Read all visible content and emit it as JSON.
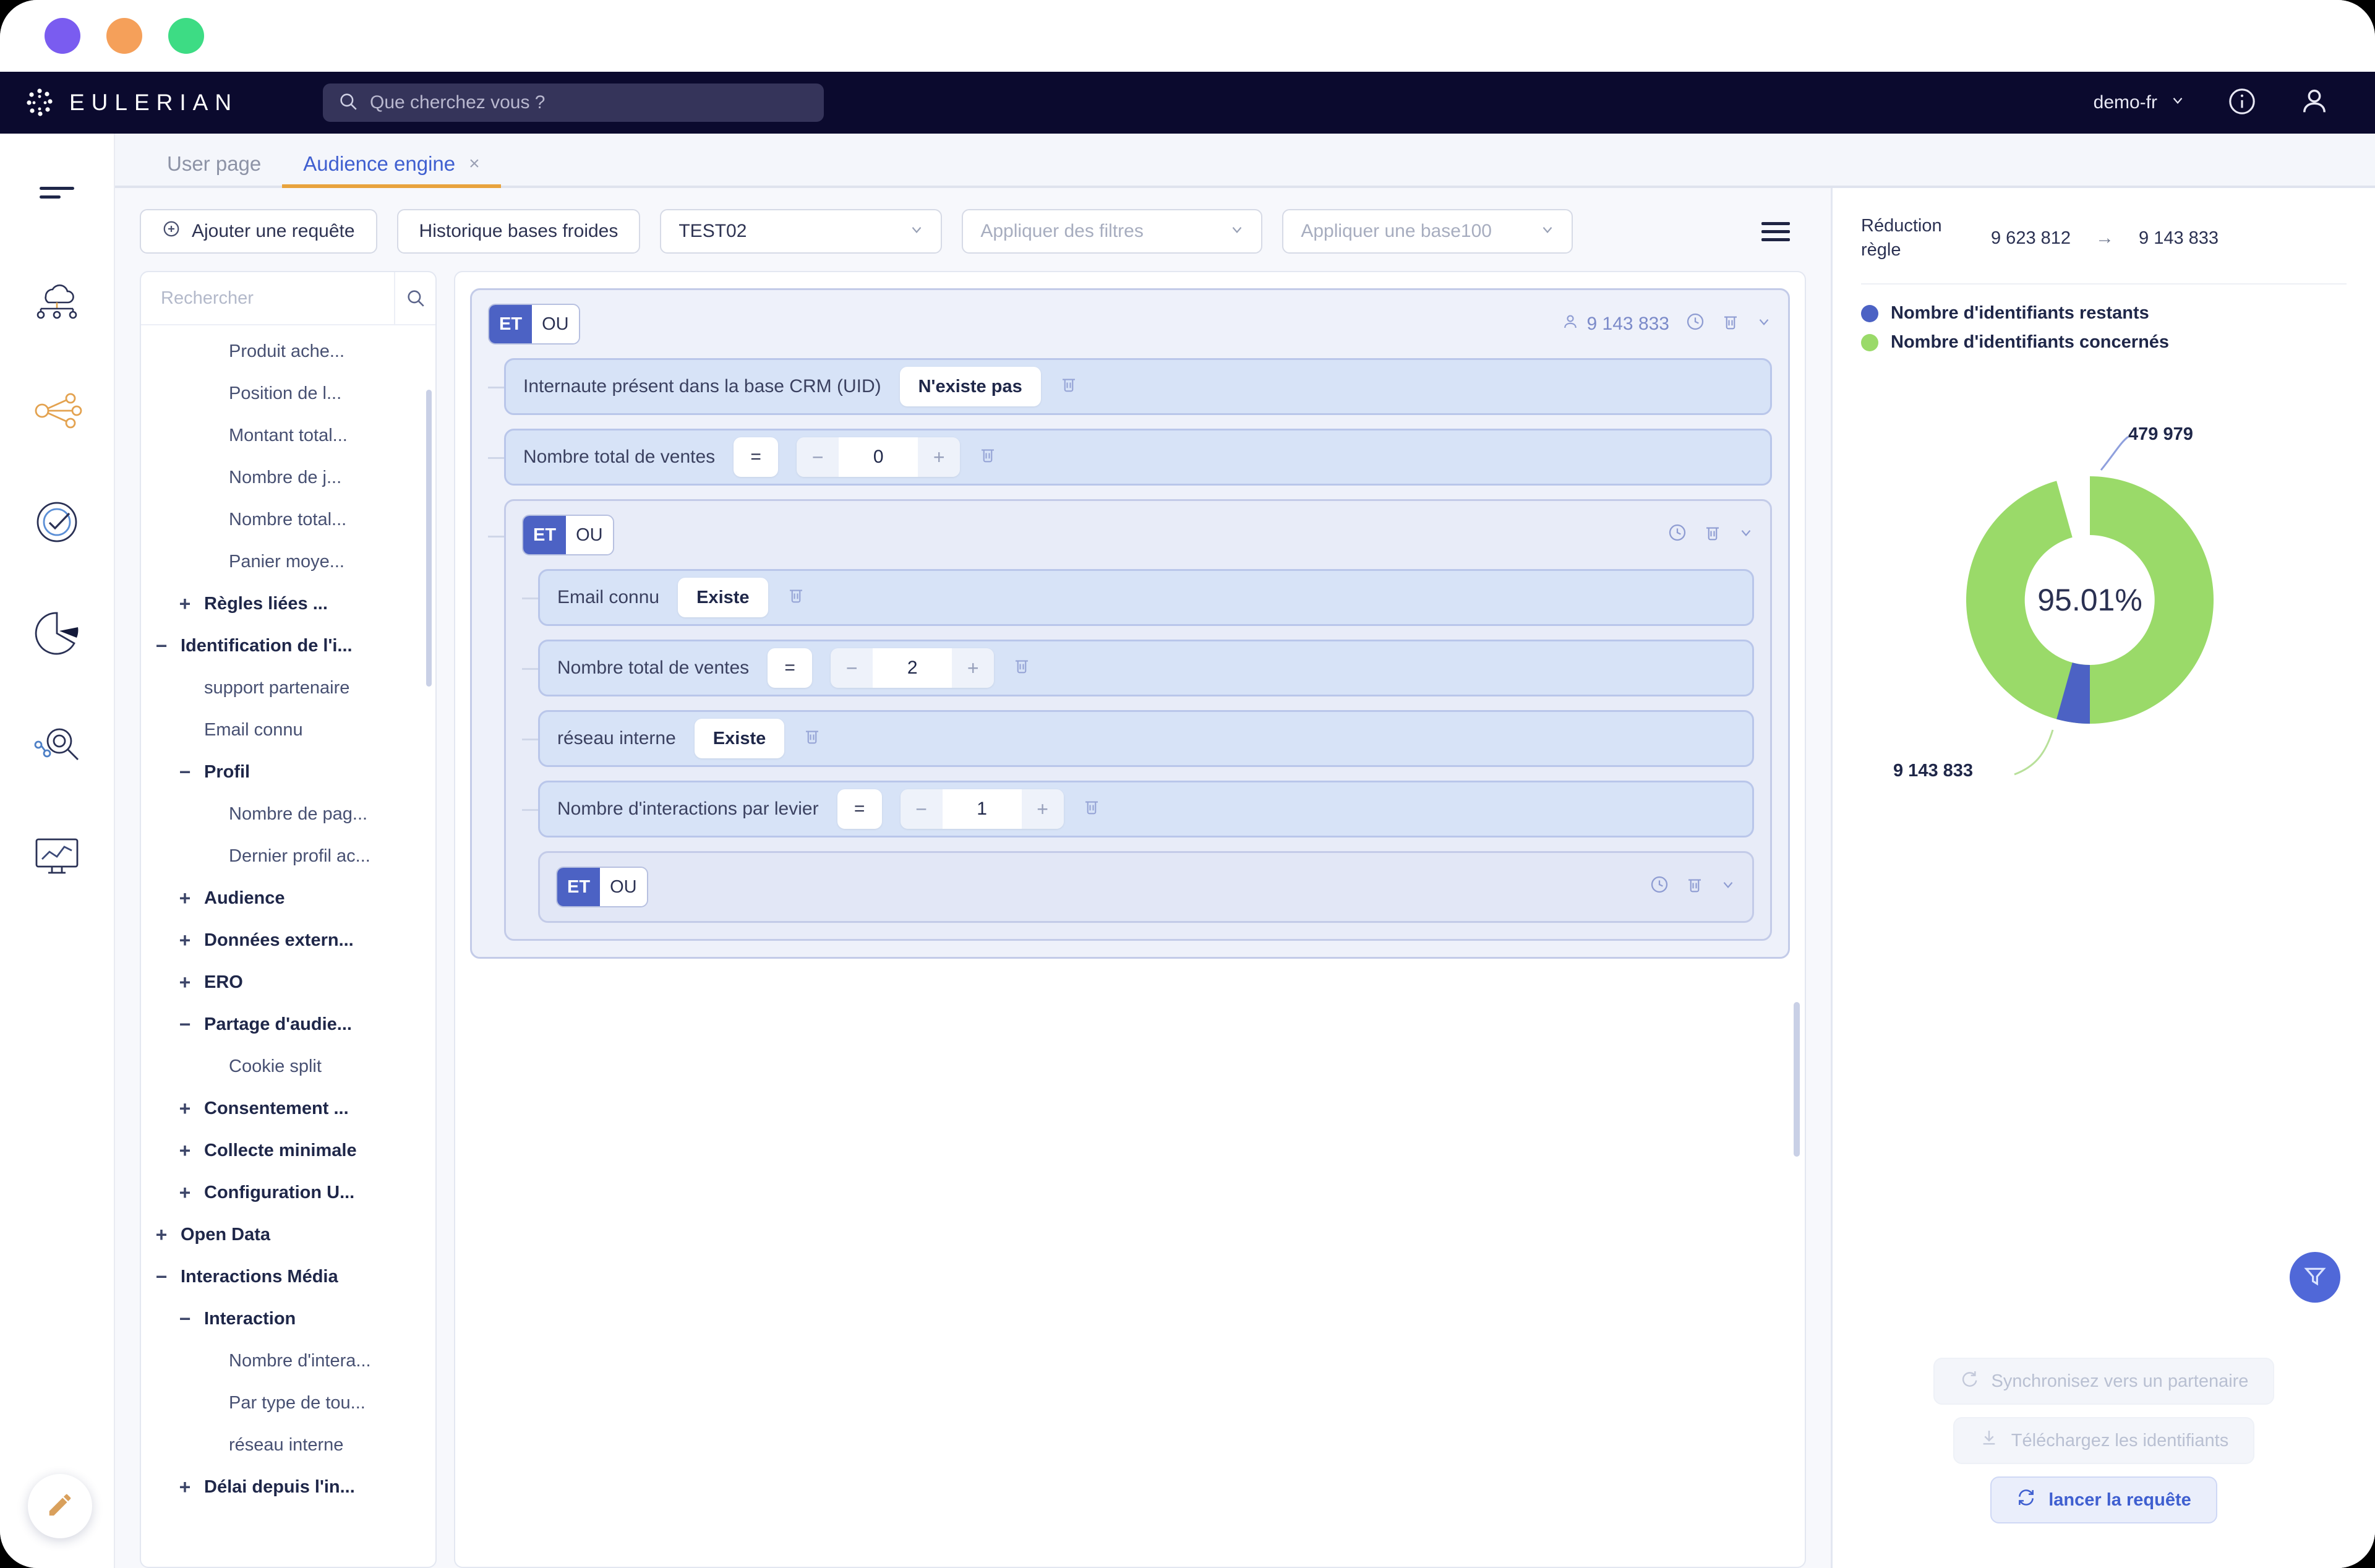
{
  "window": {
    "traffic_lights": [
      "close-purple",
      "minimize-orange",
      "zoom-green"
    ]
  },
  "header": {
    "brand": "EULERIAN",
    "search_placeholder": "Que cherchez vous ?",
    "account": "demo-fr",
    "info_icon": "info-icon",
    "user_icon": "user-icon"
  },
  "rail": {
    "items": [
      {
        "name": "menu-icon",
        "label": "menu"
      },
      {
        "name": "cloud-network-icon",
        "label": "Collecte"
      },
      {
        "name": "share-nodes-icon",
        "label": "Partage"
      },
      {
        "name": "target-check-icon",
        "label": "Objectifs"
      },
      {
        "name": "pie-chart-icon",
        "label": "Analyses"
      },
      {
        "name": "search-insights-icon",
        "label": "Exploration"
      },
      {
        "name": "monitor-chart-icon",
        "label": "Dashboards"
      }
    ],
    "fab_icon": "pencil-icon"
  },
  "tabs": [
    {
      "label": "User page",
      "active": false,
      "closable": false
    },
    {
      "label": "Audience engine",
      "active": true,
      "closable": true,
      "close_label": "×"
    }
  ],
  "toolbar": {
    "add_query_label": "Ajouter une requête",
    "add_query_icon": "plus-circle-icon",
    "cold_bases_label": "Historique bases froides",
    "segment_value": "TEST02",
    "filters_placeholder": "Appliquer des filtres",
    "base100_placeholder": "Appliquer une base100",
    "menu_icon": "hamburger-menu-icon"
  },
  "tree": {
    "search_placeholder": "Rechercher",
    "search_value": "",
    "search_icon": "search-icon",
    "nodes": [
      {
        "label": "Produit ache...",
        "level": 2,
        "toggle": "",
        "bold": false
      },
      {
        "label": "Position de l...",
        "level": 2,
        "toggle": "",
        "bold": false
      },
      {
        "label": "Montant total...",
        "level": 2,
        "toggle": "",
        "bold": false
      },
      {
        "label": "Nombre de j...",
        "level": 2,
        "toggle": "",
        "bold": false
      },
      {
        "label": "Nombre total...",
        "level": 2,
        "toggle": "",
        "bold": false
      },
      {
        "label": "Panier moye...",
        "level": 2,
        "toggle": "",
        "bold": false
      },
      {
        "label": "Règles liées ...",
        "level": 1,
        "toggle": "+",
        "bold": true
      },
      {
        "label": "Identification de l'i...",
        "level": 0,
        "toggle": "−",
        "bold": true
      },
      {
        "label": "support partenaire",
        "level": 1,
        "toggle": "",
        "bold": false
      },
      {
        "label": "Email connu",
        "level": 1,
        "toggle": "",
        "bold": false
      },
      {
        "label": "Profil",
        "level": 1,
        "toggle": "−",
        "bold": true
      },
      {
        "label": "Nombre de pag...",
        "level": 2,
        "toggle": "",
        "bold": false
      },
      {
        "label": "Dernier profil ac...",
        "level": 2,
        "toggle": "",
        "bold": false
      },
      {
        "label": "Audience",
        "level": 1,
        "toggle": "+",
        "bold": true
      },
      {
        "label": "Données extern...",
        "level": 1,
        "toggle": "+",
        "bold": true
      },
      {
        "label": "ERO",
        "level": 1,
        "toggle": "+",
        "bold": true
      },
      {
        "label": "Partage d'audie...",
        "level": 1,
        "toggle": "−",
        "bold": true
      },
      {
        "label": "Cookie split",
        "level": 2,
        "toggle": "",
        "bold": false
      },
      {
        "label": "Consentement ...",
        "level": 1,
        "toggle": "+",
        "bold": true
      },
      {
        "label": "Collecte minimale",
        "level": 1,
        "toggle": "+",
        "bold": true
      },
      {
        "label": "Configuration U...",
        "level": 1,
        "toggle": "+",
        "bold": true
      },
      {
        "label": "Open Data",
        "level": 0,
        "toggle": "+",
        "bold": true
      },
      {
        "label": "Interactions Média",
        "level": 0,
        "toggle": "−",
        "bold": true
      },
      {
        "label": "Interaction",
        "level": 1,
        "toggle": "−",
        "bold": true
      },
      {
        "label": "Nombre d'intera...",
        "level": 2,
        "toggle": "",
        "bold": false
      },
      {
        "label": "Par type de tou...",
        "level": 2,
        "toggle": "",
        "bold": false
      },
      {
        "label": "réseau interne",
        "level": 2,
        "toggle": "",
        "bold": false
      },
      {
        "label": "Délai depuis l'in...",
        "level": 1,
        "toggle": "+",
        "bold": true
      }
    ]
  },
  "query": {
    "root": {
      "operator_on": "ET",
      "operator_off": "OU",
      "count": "9 143 833",
      "count_icon": "user-count-icon",
      "clock_icon": "history-icon",
      "delete_icon": "trash-icon",
      "caret_icon": "chevron-down-icon"
    },
    "rules_level1": [
      {
        "label": "Internaute présent dans la base CRM (UID)",
        "kind": "exists",
        "chip": "N'existe pas",
        "delete_icon": "trash-icon"
      },
      {
        "label": "Nombre total de ventes",
        "kind": "number",
        "operator": "=",
        "minus": "−",
        "value": "0",
        "plus": "+",
        "delete_icon": "trash-icon"
      }
    ],
    "group2": {
      "operator_on": "ET",
      "operator_off": "OU",
      "clock_icon": "history-icon",
      "delete_icon": "trash-icon",
      "caret_icon": "chevron-down-icon",
      "rules": [
        {
          "label": "Email connu",
          "kind": "exists",
          "chip": "Existe",
          "delete_icon": "trash-icon"
        },
        {
          "label": "Nombre total de ventes",
          "kind": "number",
          "operator": "=",
          "minus": "−",
          "value": "2",
          "plus": "+",
          "delete_icon": "trash-icon"
        },
        {
          "label": "réseau interne",
          "kind": "exists",
          "chip": "Existe",
          "delete_icon": "trash-icon"
        },
        {
          "label": "Nombre d'interactions par levier",
          "kind": "number",
          "operator": "=",
          "minus": "−",
          "value": "1",
          "plus": "+",
          "delete_icon": "trash-icon"
        }
      ],
      "group3": {
        "operator_on": "ET",
        "operator_off": "OU",
        "clock_icon": "history-icon",
        "delete_icon": "trash-icon",
        "caret_icon": "chevron-down-icon"
      }
    }
  },
  "panel": {
    "reduction_label": "Réduction règle",
    "reduction_from": "9 623 812",
    "reduction_arrow": "→",
    "reduction_to": "9 143 833",
    "legend": [
      {
        "label": "Nombre d'identifiants restants",
        "color": "#4c62c4"
      },
      {
        "label": "Nombre d'identifiants concernés",
        "color": "#9ada69"
      }
    ],
    "filter_fab_icon": "funnel-icon",
    "actions": [
      {
        "label": "Synchronisez vers un partenaire",
        "icon": "sync-arrow-icon",
        "state": "disabled"
      },
      {
        "label": "Téléchargez les identifiants",
        "icon": "download-icon",
        "state": "disabled"
      },
      {
        "label": "lancer la requête",
        "icon": "refresh-icon",
        "state": "primary"
      }
    ]
  },
  "chart_data": {
    "type": "pie",
    "title": "",
    "subtype": "donut",
    "center_label": "95.01%",
    "categories": [
      "Nombre d'identifiants restants",
      "Nombre d'identifiants concernés"
    ],
    "values": [
      479979,
      9143833
    ],
    "value_labels": [
      "479 979",
      "9 143 833"
    ],
    "colors": [
      "#4c62c4",
      "#9ada69"
    ],
    "percentages": [
      4.99,
      95.01
    ],
    "legend_position": "top",
    "total": 9623812
  }
}
